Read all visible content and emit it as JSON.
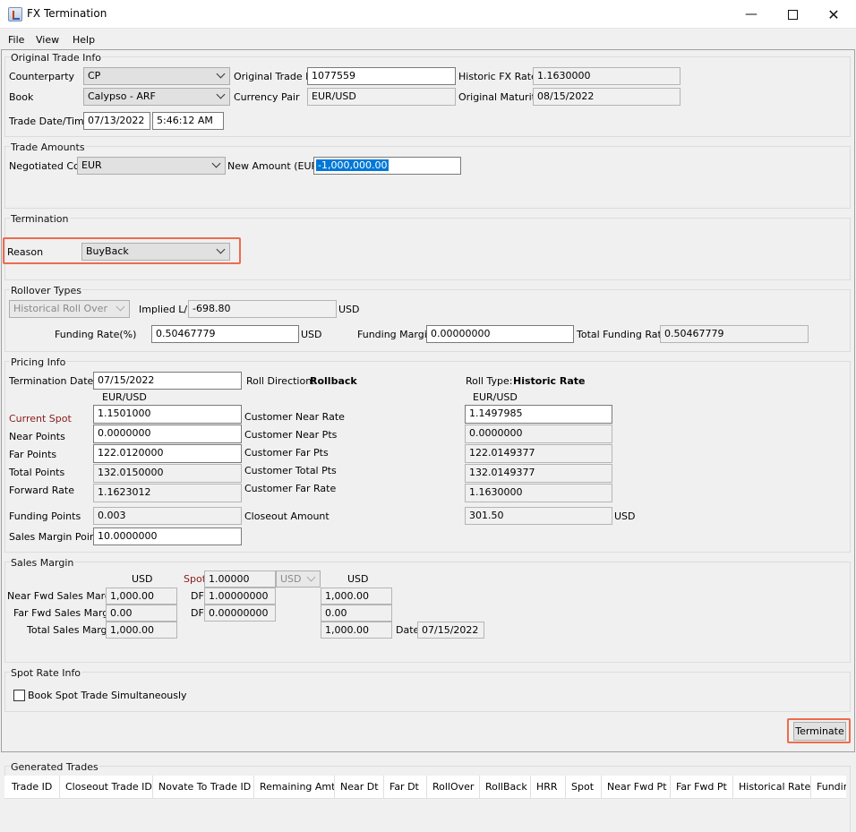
{
  "window": {
    "title": "FX Termination"
  },
  "menu": [
    "File",
    "View",
    "Help"
  ],
  "original_trade_info": {
    "title": "Original Trade Info",
    "counterparty_label": "Counterparty",
    "counterparty": "CP",
    "original_trade_id_label": "Original Trade ID",
    "original_trade_id": "1077559",
    "historic_fx_rate_label": "Historic FX Rate",
    "historic_fx_rate": "1.1630000",
    "book_label": "Book",
    "book": "Calypso - ARF",
    "currency_pair_label": "Currency Pair",
    "currency_pair": "EUR/USD",
    "original_maturity_label": "Original Maturity",
    "original_maturity": "08/15/2022",
    "trade_datetime_label": "Trade Date/Time",
    "trade_date": "07/13/2022",
    "trade_time": "5:46:12 AM"
  },
  "trade_amounts": {
    "title": "Trade Amounts",
    "negotiated_ccy_label": "Negotiated Ccy",
    "negotiated_ccy": "EUR",
    "new_amount_label": "New Amount (EUR)",
    "new_amount": "-1,000,000.00"
  },
  "termination": {
    "title": "Termination",
    "reason_label": "Reason",
    "reason": "BuyBack"
  },
  "rollover_types": {
    "title": "Rollover Types",
    "roll_type": "Historical Roll Over",
    "implied_ld_label": "Implied L/D",
    "implied_ld": "-698.80",
    "implied_ld_ccy": "USD",
    "funding_rate_label": "Funding Rate(%)",
    "funding_rate": "0.50467779",
    "funding_rate_ccy": "USD",
    "funding_margin_label": "Funding Margin",
    "funding_margin": "0.00000000",
    "total_funding_rate_label": "Total Funding Rate",
    "total_funding_rate": "0.50467779"
  },
  "pricing_info": {
    "title": "Pricing Info",
    "termination_date_label": "Termination Date",
    "termination_date": "07/15/2022",
    "roll_direction_label": "Roll Direction:",
    "roll_direction": "Rollback",
    "roll_type_label": "Roll Type:",
    "roll_type": "Historic Rate",
    "pair_left": "EUR/USD",
    "pair_right": "EUR/USD",
    "current_spot_label": "Current Spot",
    "current_spot": "1.1501000",
    "near_points_label": "Near Points",
    "near_points": "0.0000000",
    "far_points_label": "Far Points",
    "far_points": "122.0120000",
    "total_points_label": "Total Points",
    "total_points": "132.0150000",
    "forward_rate_label": "Forward Rate",
    "forward_rate": "1.1623012",
    "customer_near_rate_label": "Customer Near Rate",
    "customer_near_rate": "1.1497985",
    "customer_near_pts_label": "Customer Near Pts",
    "customer_near_pts": "0.0000000",
    "customer_far_pts_label": "Customer Far Pts",
    "customer_far_pts": "122.0149377",
    "customer_total_pts_label": "Customer Total Pts",
    "customer_total_pts": "132.0149377",
    "customer_far_rate_label": "Customer Far Rate",
    "customer_far_rate": "1.1630000",
    "funding_points_label": "Funding Points",
    "funding_points": "0.003",
    "closeout_amount_label": "Closeout Amount",
    "closeout_amount": "301.50",
    "closeout_ccy": "USD",
    "sales_margin_points_label": "Sales Margin Points",
    "sales_margin_points": "10.0000000"
  },
  "sales_margin": {
    "title": "Sales Margin",
    "ccy_left": "USD",
    "spot_label": "Spot",
    "spot": "1.00000",
    "spot_ccy": "USD",
    "ccy_right": "USD",
    "near_fwd_label": "Near Fwd Sales Margin",
    "near_fwd": "1,000.00",
    "near_df_label": "DF",
    "near_df": "1.00000000",
    "near_right": "1,000.00",
    "far_fwd_label": "Far Fwd Sales Margin",
    "far_fwd": "0.00",
    "far_df_label": "DF",
    "far_df": "0.00000000",
    "far_right": "0.00",
    "total_label": "Total Sales Margin",
    "total": "1,000.00",
    "total_right": "1,000.00",
    "date_label": "Date",
    "date": "07/15/2022"
  },
  "spot_rate_info": {
    "title": "Spot Rate Info",
    "book_spot_label": "Book Spot Trade Simultaneously"
  },
  "actions": {
    "terminate": "Terminate"
  },
  "generated_trades": {
    "title": "Generated Trades",
    "columns": [
      "Trade ID",
      "Closeout Trade ID",
      "Novate To Trade ID",
      "Remaining Amt",
      "Near Dt",
      "Far Dt",
      "RollOver",
      "RollBack",
      "HRR",
      "Spot",
      "Near Fwd Pt",
      "Far Fwd Pt",
      "Historical Rate",
      "Fundin"
    ]
  }
}
